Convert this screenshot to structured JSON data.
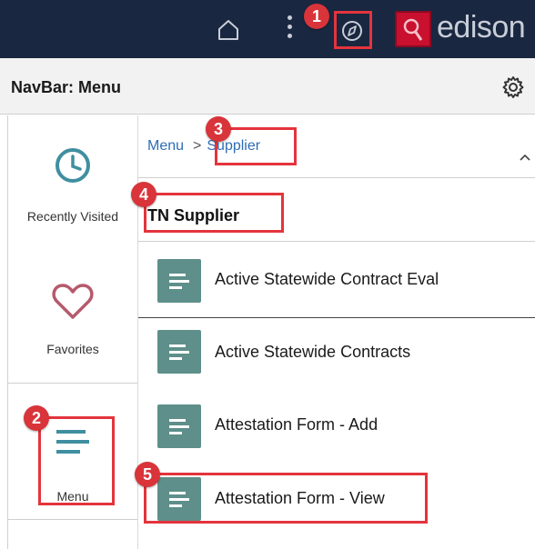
{
  "topbar": {
    "logo_text": "edison",
    "icons": {
      "home": "home-icon",
      "actions": "kebab-menu-icon",
      "navigator": "compass-icon"
    }
  },
  "header": {
    "title": "NavBar: Menu",
    "settings_icon": "gear-icon"
  },
  "left_nav": {
    "items": [
      {
        "label": "Recently Visited",
        "icon": "clock-icon"
      },
      {
        "label": "Favorites",
        "icon": "heart-icon"
      },
      {
        "label": "Menu",
        "icon": "menu-lines-icon"
      }
    ]
  },
  "content": {
    "breadcrumb": {
      "root": "Menu",
      "separator": ">",
      "current": "Supplier"
    },
    "section_title": "TN Supplier",
    "items": [
      {
        "label": "Active Statewide Contract Eval",
        "icon": "document-icon"
      },
      {
        "label": "Active Statewide Contracts",
        "icon": "document-icon"
      },
      {
        "label": "Attestation Form - Add",
        "icon": "document-icon"
      },
      {
        "label": "Attestation Form - View",
        "icon": "document-icon"
      }
    ]
  },
  "callouts": [
    "1",
    "2",
    "3",
    "4",
    "5"
  ],
  "colors": {
    "topbar": "#1a2740",
    "tile": "#5e8f8a",
    "accent_icon": "#3f8fa0",
    "callout": "#e4343c",
    "link": "#2f6db5"
  }
}
